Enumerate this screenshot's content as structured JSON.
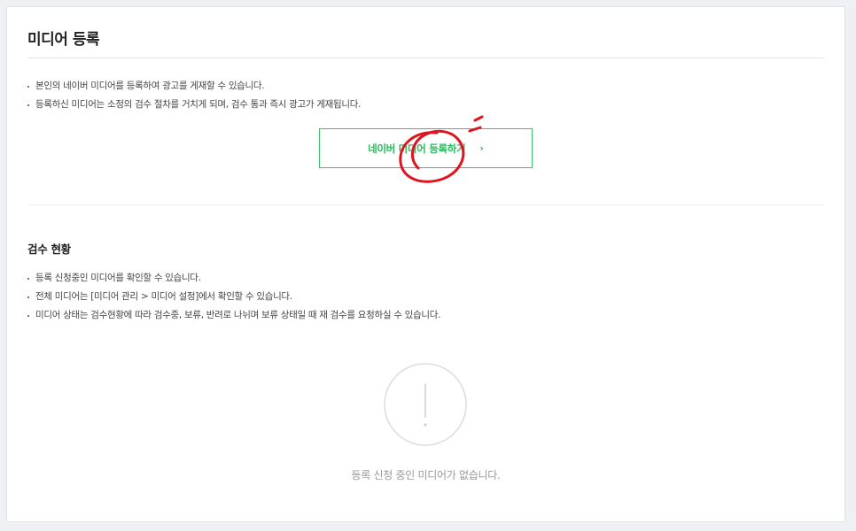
{
  "page": {
    "title": "미디어 등록"
  },
  "register": {
    "notes": [
      "본인의 네이버 미디어를 등록하여 광고를 게재할 수 있습니다.",
      "등록하신 미디어는 소정의 검수 절차를 거치게 되며, 검수 통과 즉시 광고가 게재됩니다."
    ],
    "button_label": "네이버 미디어 등록하기",
    "button_icon": "chevron-right-icon",
    "accent_color": "#2db95f"
  },
  "review": {
    "title": "검수 현황",
    "notes": [
      "등록 신청중인 미디어를 확인할 수 있습니다.",
      "전체 미디어는 [미디어 관리 > 미디어 설정]에서 확인할 수 있습니다.",
      "미디어 상태는 검수현황에 따라 검수중, 보류, 반려로 나뉘며 보류 상태일 때 재 검수를 요청하실 수 있습니다."
    ],
    "empty_icon": "exclamation-circle-icon",
    "empty_message": "등록 신청 중인 미디어가 없습니다."
  },
  "annotation": {
    "color": "#e0141e"
  }
}
